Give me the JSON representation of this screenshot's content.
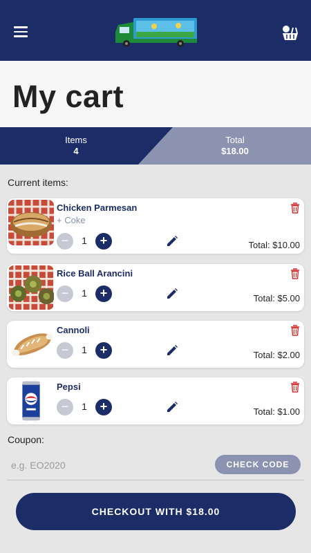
{
  "header": {
    "menu_icon": "hamburger-menu-icon",
    "logo_icon": "food-truck-logo",
    "cart_icon": "shopping-basket-icon"
  },
  "page": {
    "title": "My cart"
  },
  "summary": {
    "items_label": "Items",
    "items_value": "4",
    "total_label": "Total",
    "total_value": "$18.00"
  },
  "cart": {
    "section_label": "Current items:",
    "items": [
      {
        "name": "Chicken Parmesan",
        "modifier": "+ Coke",
        "quantity": "1",
        "total": "Total: $10.00"
      },
      {
        "name": "Rice Ball Arancini",
        "modifier": "",
        "quantity": "1",
        "total": "Total: $5.00"
      },
      {
        "name": "Cannoli",
        "modifier": "",
        "quantity": "1",
        "total": "Total: $2.00"
      },
      {
        "name": "Pepsi",
        "modifier": "",
        "quantity": "1",
        "total": "Total: $1.00"
      }
    ],
    "minus_symbol": "−",
    "plus_symbol": "+"
  },
  "coupon": {
    "label": "Coupon:",
    "placeholder": "e.g. EO2020",
    "value": "",
    "check_label": "CHECK CODE"
  },
  "checkout": {
    "label": "CHECKOUT WITH $18.00"
  },
  "colors": {
    "primary": "#1c2c66",
    "secondary": "#8b93b0",
    "delete": "#d32f2f",
    "background": "#e6e6e6"
  }
}
